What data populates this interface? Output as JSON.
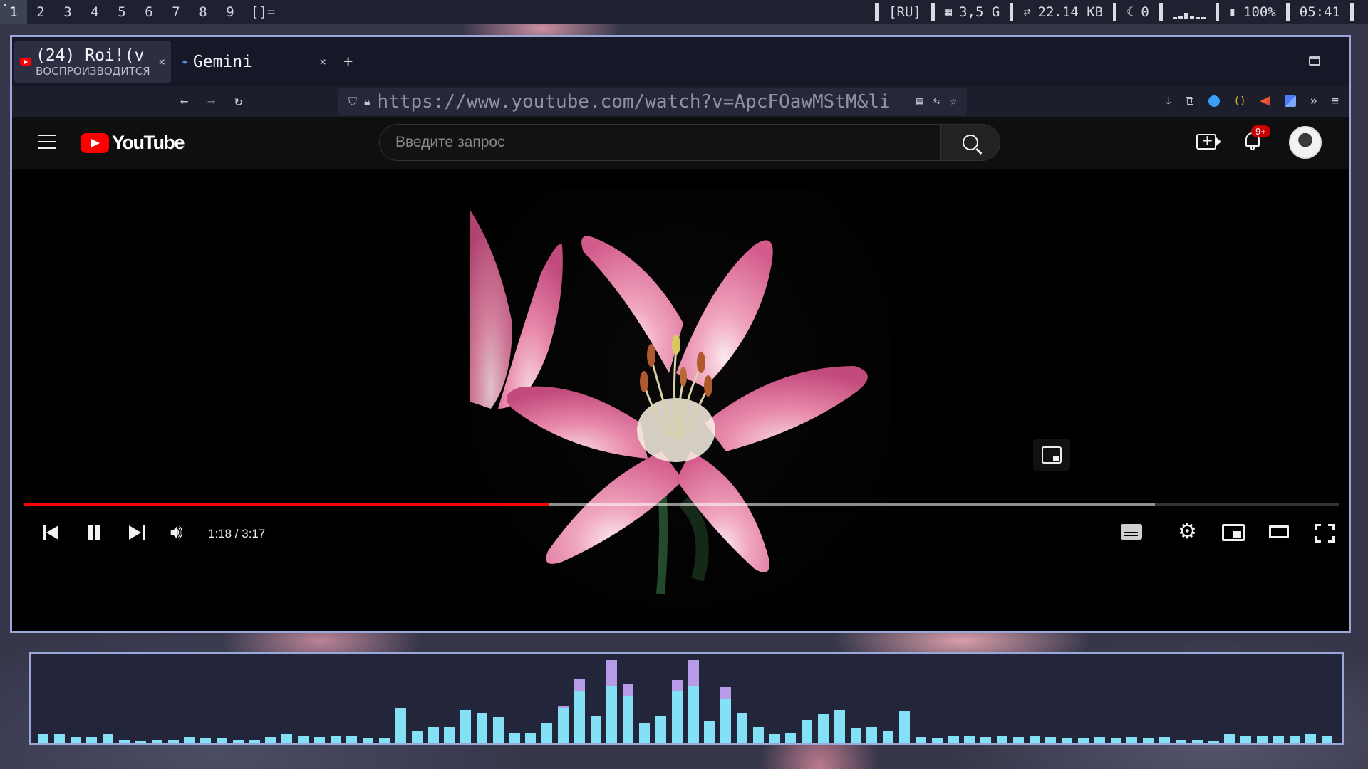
{
  "topbar": {
    "workspaces": [
      "1",
      "2",
      "3",
      "4",
      "5",
      "6",
      "7",
      "8",
      "9"
    ],
    "active_workspace": "1",
    "layout_symbol": "[]=",
    "keyboard_layout": "[RU]",
    "memory": "3,5 G",
    "network": "22.14 KB",
    "count": "0",
    "battery": "100%",
    "clock": "05:41"
  },
  "browser": {
    "tabs": [
      {
        "title": "(24) Roi!(v",
        "subtitle": "ВОСПРОИЗВОДИТСЯ",
        "close": "×"
      },
      {
        "title": "Gemini",
        "close": "×"
      }
    ],
    "new_tab": "+",
    "url": "https://www.youtube.com/watch?v=ApcFOawMStM&li"
  },
  "youtube": {
    "logo_text": "YouTube",
    "search_placeholder": "Введите запрос",
    "notification_badge": "9+",
    "player": {
      "time": "1:18 / 3:17",
      "played_fraction": 0.4,
      "loaded_fraction": 0.86
    }
  },
  "colors": {
    "youtube_red": "#ff0000",
    "window_border": "#9aa7d8",
    "visualizer_bar": "#84e0f5",
    "visualizer_peak": "#b79be8"
  },
  "icons": {
    "tab_favicon": "youtube-icon",
    "gemini_tab": "gemini-star-icon",
    "search": "search-icon",
    "notifications": "bell-icon",
    "create": "create-video-icon"
  },
  "visualizer": {
    "levels": [
      6,
      6,
      4,
      4,
      6,
      2,
      1,
      2,
      2,
      4,
      3,
      3,
      2,
      2,
      4,
      6,
      5,
      4,
      5,
      5,
      3,
      3,
      24,
      8,
      11,
      11,
      23,
      21,
      18,
      7,
      7,
      14,
      24,
      36,
      19,
      40,
      33,
      14,
      19,
      36,
      40,
      15,
      31,
      21,
      11,
      6,
      7,
      16,
      20,
      23,
      10,
      11,
      8,
      22,
      4,
      3,
      5,
      5,
      4,
      5,
      4,
      5,
      4,
      3,
      3,
      4,
      3,
      4,
      3,
      4,
      2,
      2,
      1,
      6,
      5,
      5,
      5,
      5,
      6,
      5
    ],
    "peaks": [
      0,
      0,
      0,
      0,
      0,
      0,
      0,
      0,
      0,
      0,
      0,
      0,
      0,
      0,
      0,
      0,
      0,
      0,
      0,
      0,
      0,
      0,
      0,
      0,
      0,
      0,
      0,
      0,
      0,
      0,
      0,
      0,
      2,
      9,
      0,
      18,
      8,
      0,
      0,
      8,
      18,
      0,
      8,
      0,
      0,
      0,
      0,
      0,
      0,
      0,
      0,
      0,
      0,
      0,
      0,
      0,
      0,
      0,
      0,
      0,
      0,
      0,
      0,
      0,
      0,
      0,
      0,
      0,
      0,
      0,
      0,
      0,
      0,
      0,
      0,
      0,
      0,
      0,
      0,
      0
    ]
  }
}
